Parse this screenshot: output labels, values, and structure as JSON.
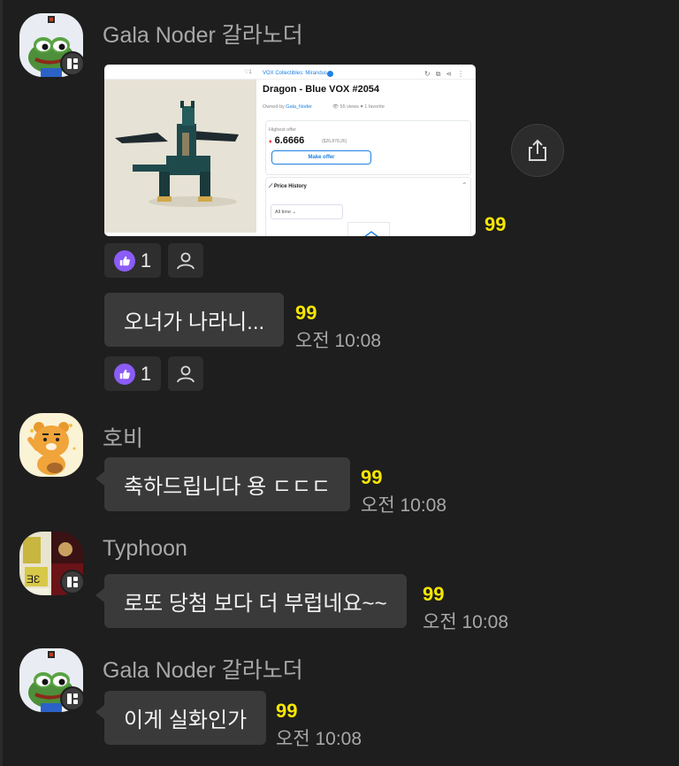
{
  "colors": {
    "background": "#1e1e1e",
    "bubble": "#3a3a3a",
    "unread": "#f7e600",
    "like": "#8b5cf6",
    "secondary_text": "#a8a8a8"
  },
  "messages": [
    {
      "sender": "Gala Noder 갈라노더",
      "avatar_icon": "frog-pepe-avatar",
      "has_platform_badge": true,
      "image_card": {
        "like_count": "1",
        "collection": "VOX Collectibles: Mirandus",
        "title": "Dragon - Blue VOX #2054",
        "owned_by_label": "Owned by",
        "owner": "Gala_Noder",
        "views": "55 views",
        "favorites": "1 favorite",
        "highest_offer_label": "Highest offer",
        "price": "6.6666",
        "price_usd": "($26,878.26)",
        "make_offer": "Make offer",
        "price_history": "Price History",
        "time_filter": "All time"
      },
      "image_unread": "99",
      "image_reactions": {
        "like_count": "1"
      },
      "text": "오너가 나라니...",
      "unread": "99",
      "time": "오전 10:08",
      "reactions": {
        "like_count": "1"
      }
    },
    {
      "sender": "호비",
      "avatar_icon": "ryan-character-avatar",
      "has_platform_badge": false,
      "text": "축하드립니다 용 ㄷㄷㄷ",
      "unread": "99",
      "time": "오전 10:08"
    },
    {
      "sender": "Typhoon",
      "avatar_icon": "lottery-collage-avatar",
      "has_platform_badge": true,
      "text": "로또 당첨 보다 더 부럽네요~~",
      "unread": "99",
      "time": "오전 10:08"
    },
    {
      "sender": "Gala Noder 갈라노더",
      "avatar_icon": "frog-pepe-avatar",
      "has_platform_badge": true,
      "text": "이게 실화인가",
      "unread": "99",
      "time": "오전 10:08"
    }
  ]
}
